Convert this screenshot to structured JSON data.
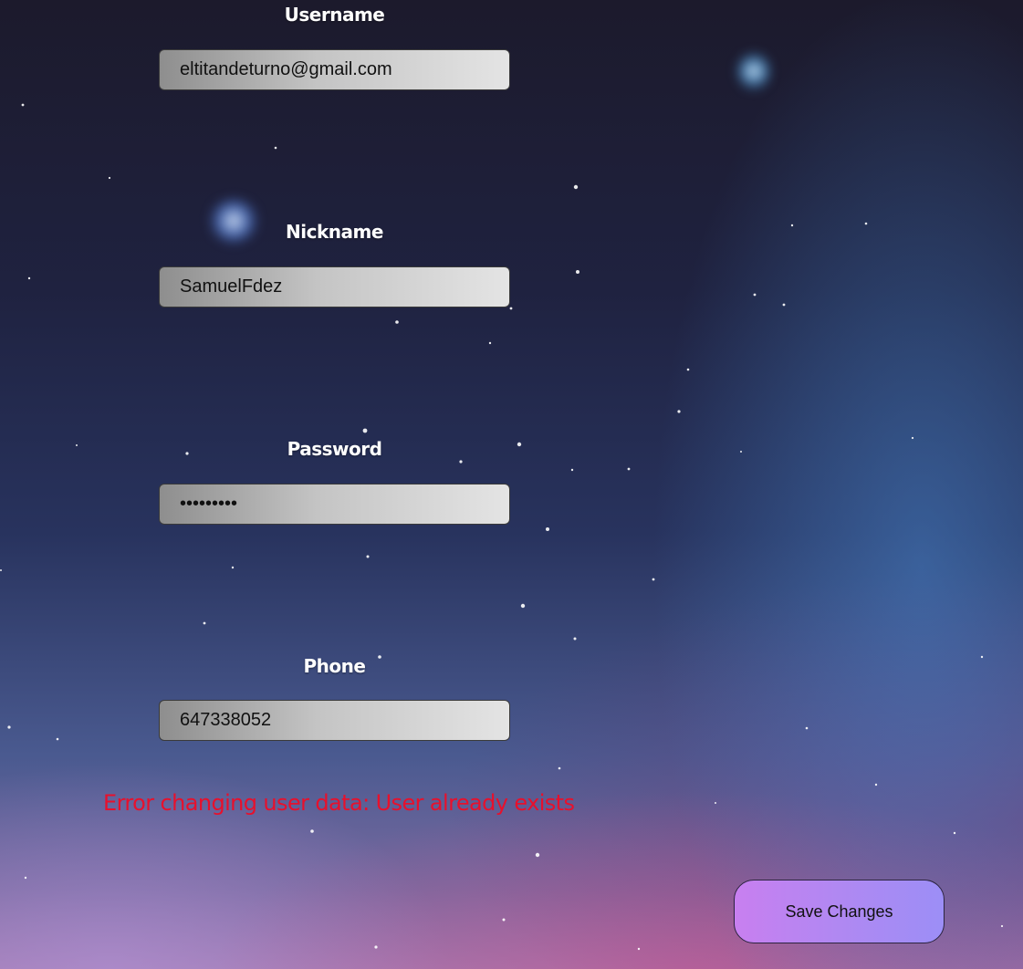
{
  "form": {
    "username": {
      "label": "Username",
      "value": "eltitandeturno@gmail.com"
    },
    "nickname": {
      "label": "Nickname",
      "value": "SamuelFdez"
    },
    "password": {
      "label": "Password",
      "value": "sssssssss"
    },
    "phone": {
      "label": "Phone",
      "value": "647338052"
    }
  },
  "error": {
    "message": "Error changing user data: User already exists",
    "color": "#e8102c"
  },
  "actions": {
    "save_label": "Save Changes"
  }
}
